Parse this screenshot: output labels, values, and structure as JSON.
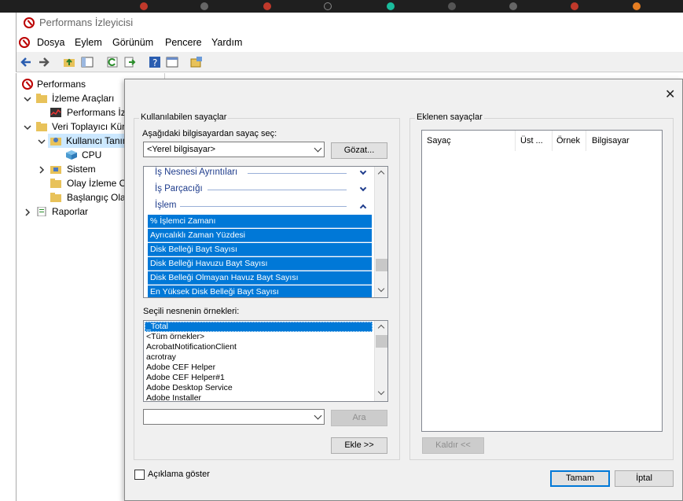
{
  "window": {
    "title": "Performans İzleyicisi",
    "menu": [
      "Dosya",
      "Eylem",
      "Görünüm",
      "Pencere",
      "Yardım"
    ]
  },
  "tree": {
    "root": "Performans",
    "monitoring_tools": "İzleme Araçları",
    "perf_monitor": "Performans İz",
    "data_collector_sets": "Veri Toplayıcı Kün",
    "user_defined": "Kullanıcı Tanım",
    "cpu": "CPU",
    "system": "Sistem",
    "event_trace": "Olay İzleme O",
    "startup_event": "Başlangıç Olay",
    "reports": "Raporlar"
  },
  "dialog": {
    "available_group": "Kullanılabilen sayaçlar",
    "select_from_label": "Aşağıdaki bilgisayardan sayaç seç:",
    "computer_value": "<Yerel bilgisayar>",
    "browse_button": "Gözat...",
    "objects": [
      {
        "label": "İş Nesnesi Ayrıntıları",
        "expanded": false
      },
      {
        "label": "İş Parçacığı",
        "expanded": false
      },
      {
        "label": "İşlem",
        "expanded": true
      }
    ],
    "counters": [
      "% İşlemci Zamanı",
      "Ayrıcalıklı Zaman Yüzdesi",
      "Disk Belleği Bayt Sayısı",
      "Disk Belleği Havuzu Bayt Sayısı",
      "Disk Belleği Olmayan Havuz Bayt Sayısı",
      "En Yüksek Disk Belleği Bayt Sayısı"
    ],
    "instances_label": "Seçili nesnenin örnekleri:",
    "instances": [
      "_Total",
      "<Tüm örnekler>",
      "AcrobatNotificationClient",
      "acrotray",
      "Adobe CEF Helper",
      "Adobe CEF Helper#1",
      "Adobe Desktop Service",
      "Adobe Installer"
    ],
    "search_value": "",
    "search_button": "Ara",
    "add_button": "Ekle >>",
    "added_group": "Eklenen sayaçlar",
    "added_columns": [
      "Sayaç",
      "Üst ...",
      "Örnek",
      "Bilgisayar"
    ],
    "remove_button": "Kaldır <<",
    "show_description_label": "Açıklama göster",
    "show_description_checked": false,
    "ok_button": "Tamam",
    "cancel_button": "İptal",
    "close_glyph": "✕"
  }
}
